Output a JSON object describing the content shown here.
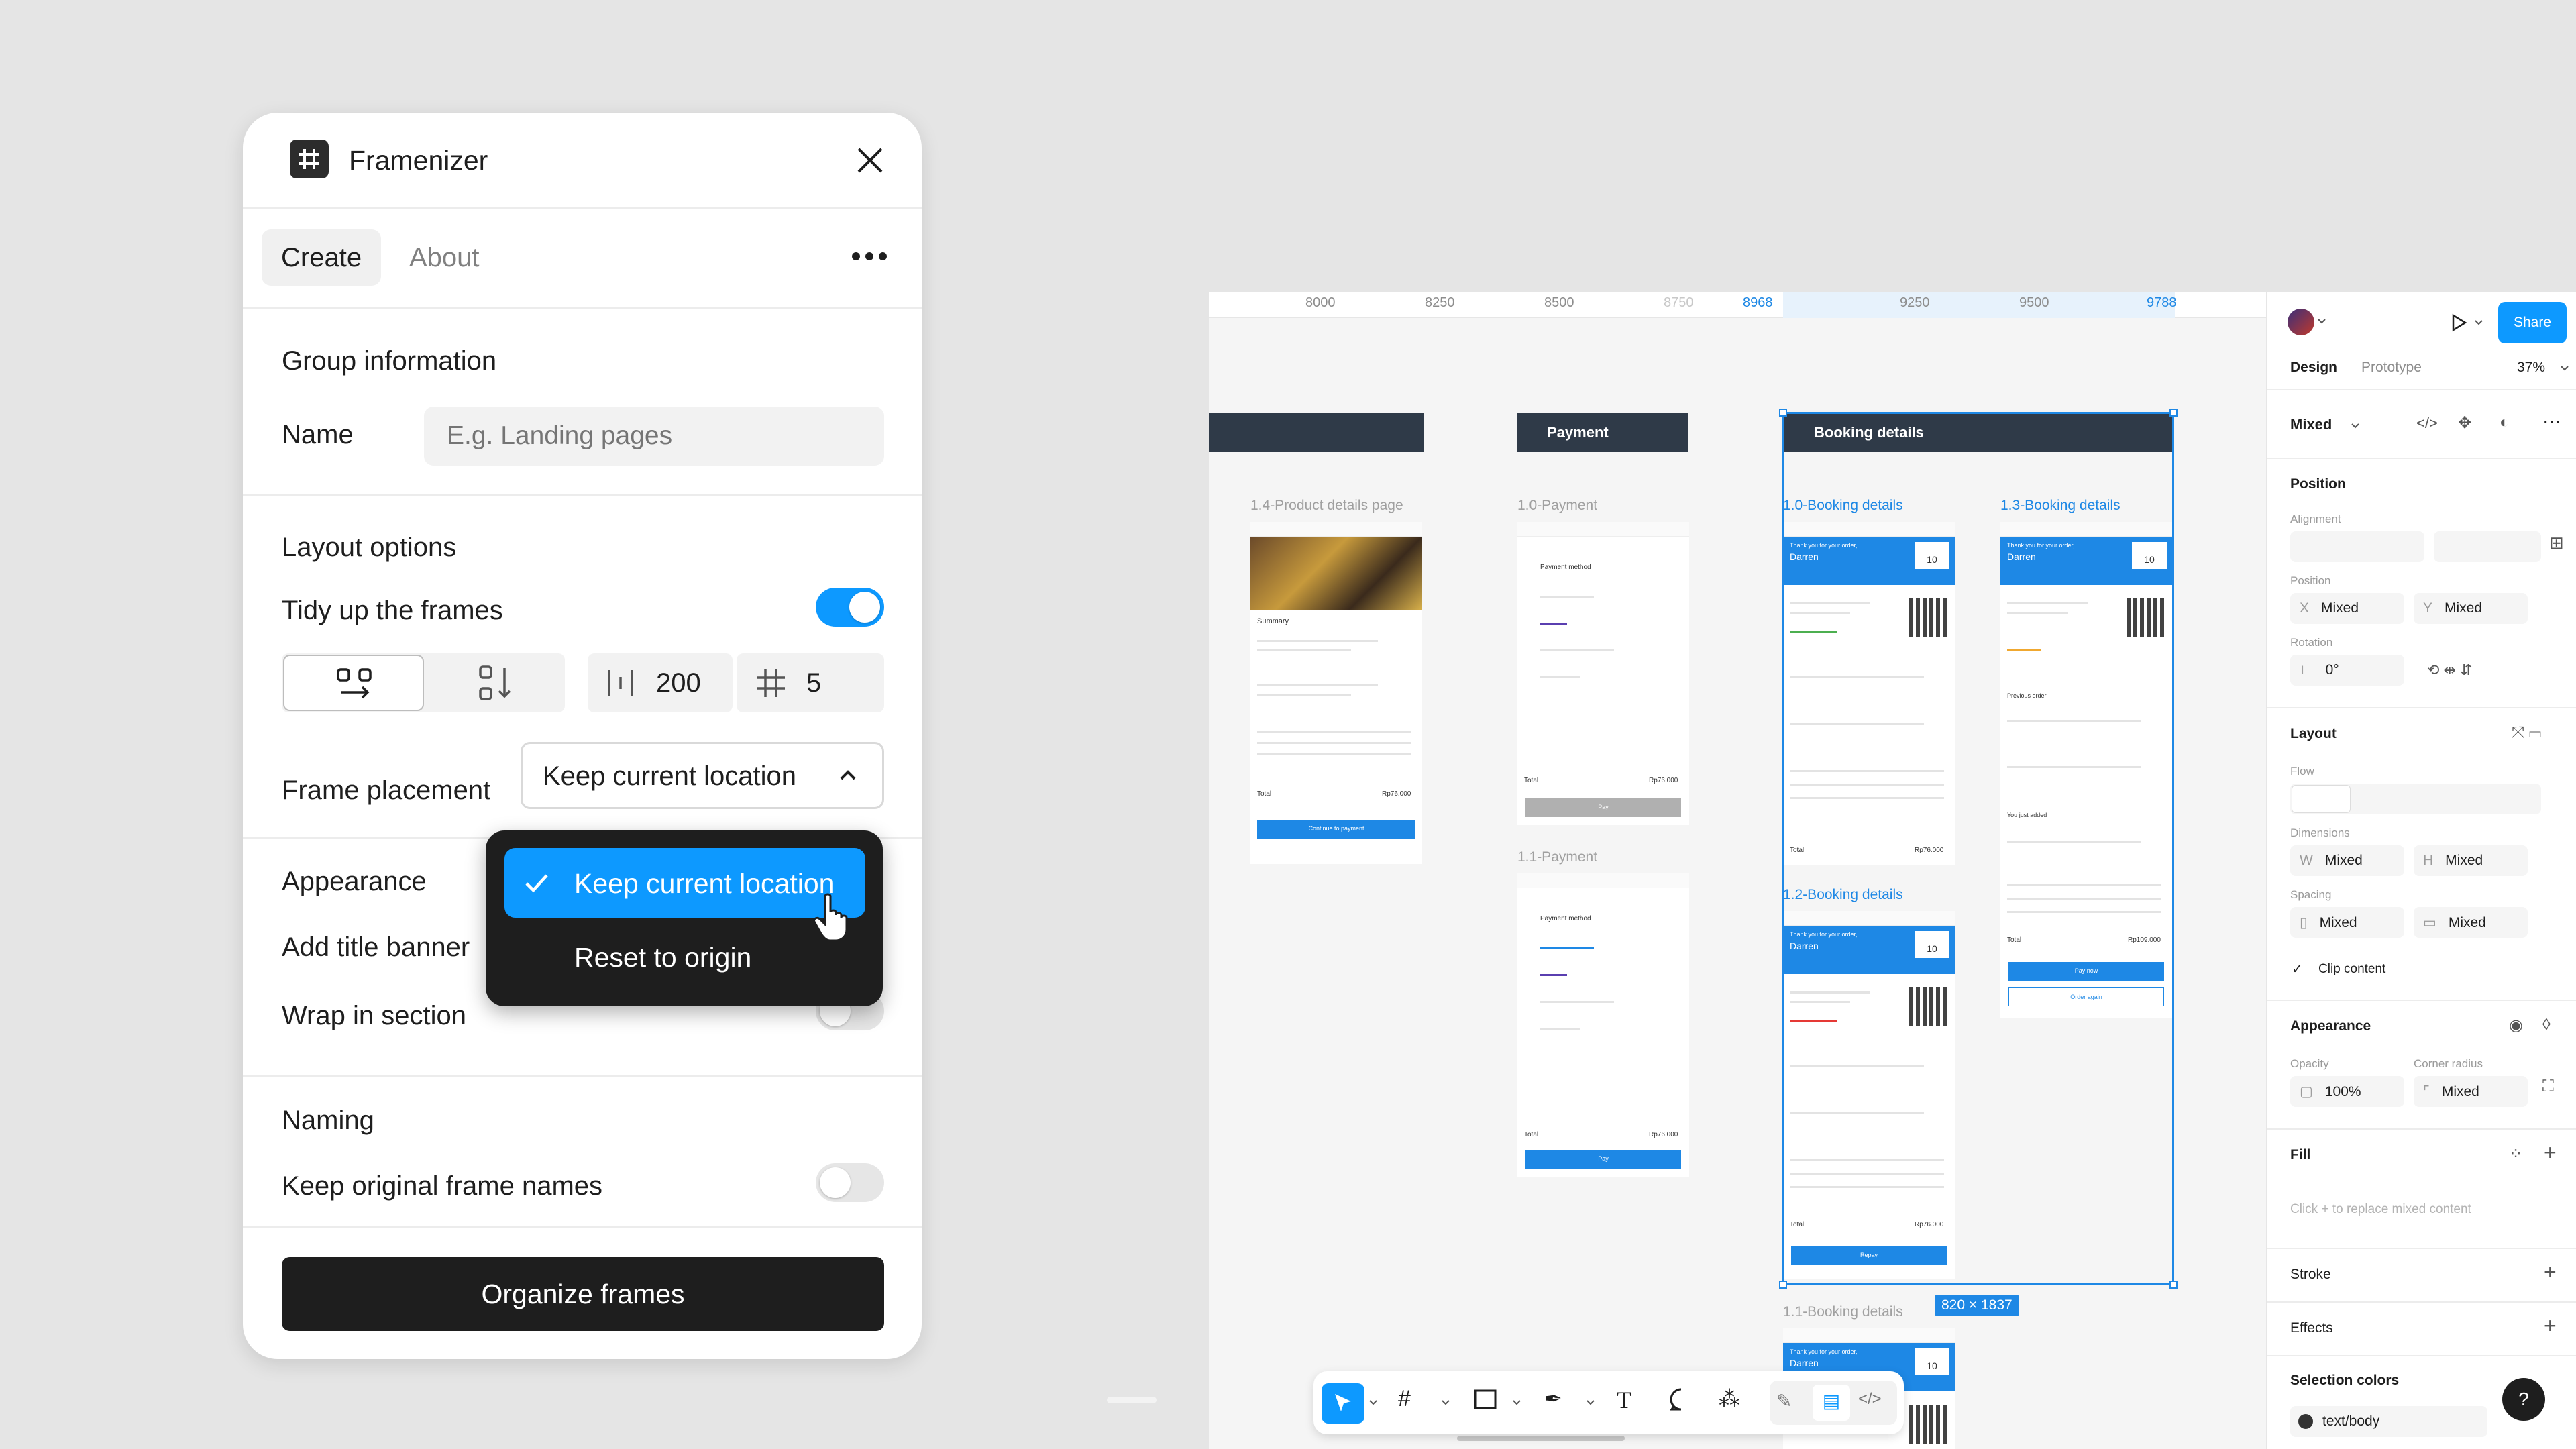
{
  "plugin": {
    "title": "Framenizer",
    "tabs": [
      "Create",
      "About"
    ],
    "group_information": {
      "heading": "Group information",
      "name_label": "Name",
      "name_placeholder": "E.g. Landing pages"
    },
    "layout_options": {
      "heading": "Layout options",
      "tidy_label": "Tidy up the frames",
      "tidy_on": true,
      "spacing": "200",
      "columns": "5",
      "frame_placement_label": "Frame placement",
      "frame_placement_value": "Keep current location"
    },
    "appearance": {
      "heading": "Appearance",
      "title_banner_label": "Add title banner",
      "wrap_section_label": "Wrap in section"
    },
    "naming": {
      "heading": "Naming",
      "keep_names_label": "Keep original frame names"
    },
    "organize_button": "Organize frames",
    "dropdown": {
      "options": [
        "Keep current location",
        "Reset to origin"
      ],
      "selected": "Keep current location"
    }
  },
  "ruler": {
    "ticks": [
      "8000",
      "8250",
      "8500",
      "8750",
      "8968",
      "9250",
      "9500",
      "9788"
    ]
  },
  "canvas": {
    "banners": [
      "Payment",
      "Booking details"
    ],
    "frames": {
      "product": "1.4-Product details page",
      "pay10": "1.0-Payment",
      "pay11": "1.1-Payment",
      "book10": "1.0-Booking details",
      "book13": "1.3-Booking details",
      "book12": "1.2-Booking details",
      "book11": "1.1-Booking details"
    },
    "mock_text": {
      "thank": "Thank you for your order,",
      "darren": "Darren",
      "table_no": "10",
      "payment_method": "Payment method",
      "total": "Total",
      "pay": "Pay",
      "summary": "Summary",
      "continue": "Continue to payment",
      "pay_now": "Pay now",
      "order_again": "Order again",
      "previous_order": "Previous order",
      "you_just_added": "You just added",
      "repay": "Repay",
      "total_price": "Rp76.000",
      "total_price_13": "Rp109.000"
    },
    "selection_size": "820 × 1837"
  },
  "right_panel": {
    "share": "Share",
    "tabs": [
      "Design",
      "Prototype"
    ],
    "zoom": "37%",
    "mixed_label": "Mixed",
    "position": {
      "heading": "Position",
      "alignment": "Alignment",
      "position_label": "Position",
      "x": "Mixed",
      "y": "Mixed",
      "rotation_label": "Rotation",
      "rotation": "0°"
    },
    "layout": {
      "heading": "Layout",
      "flow": "Flow",
      "dimensions": "Dimensions",
      "w": "Mixed",
      "h": "Mixed",
      "spacing": "Spacing",
      "spacing_a": "Mixed",
      "spacing_b": "Mixed",
      "clip_content": "Clip content"
    },
    "appearance": {
      "heading": "Appearance",
      "opacity_label": "Opacity",
      "opacity": "100%",
      "corner_label": "Corner radius",
      "corner": "Mixed"
    },
    "fill": {
      "heading": "Fill",
      "hint": "Click + to replace mixed content"
    },
    "stroke": "Stroke",
    "effects": "Effects",
    "selection_colors": {
      "heading": "Selection colors",
      "color_name": "text/body"
    },
    "help": "?"
  },
  "colors": {
    "accent": "#0d99ff",
    "dark": "#1e1e1e",
    "banner": "#2f3a48",
    "selection": "#1e88e5"
  }
}
